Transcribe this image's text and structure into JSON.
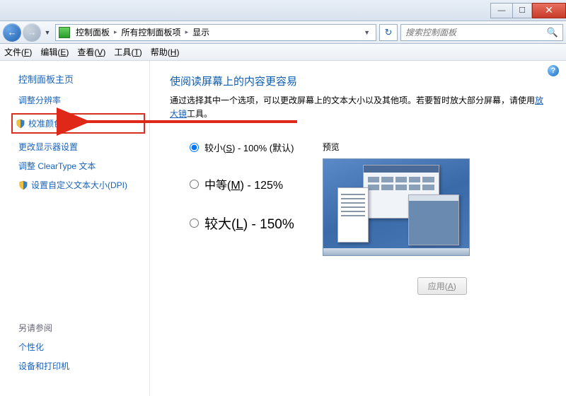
{
  "titlebar": {
    "min": "—",
    "max": "☐",
    "close": "✕"
  },
  "nav": {
    "back": "←",
    "forward": "→",
    "dropdown": "▼",
    "refresh": "↻",
    "crumbs": [
      "控制面板",
      "所有控制面板项",
      "显示"
    ],
    "sep": "▸",
    "addr_drop": "▼"
  },
  "search": {
    "placeholder": "搜索控制面板",
    "icon": "🔍"
  },
  "menu": {
    "items": [
      {
        "label": "文件",
        "key": "F"
      },
      {
        "label": "编辑",
        "key": "E"
      },
      {
        "label": "查看",
        "key": "V"
      },
      {
        "label": "工具",
        "key": "T"
      },
      {
        "label": "帮助",
        "key": "H"
      }
    ]
  },
  "sidebar": {
    "home": "控制面板主页",
    "links": [
      {
        "label": "调整分辨率",
        "shield": false
      },
      {
        "label": "校准颜色",
        "shield": true,
        "highlight": true
      },
      {
        "label": "更改显示器设置",
        "shield": false
      },
      {
        "label": "调整 ClearType 文本",
        "shield": false
      },
      {
        "label": "设置自定义文本大小(DPI)",
        "shield": true
      }
    ],
    "see_also_title": "另请参阅",
    "see_also": [
      "个性化",
      "设备和打印机"
    ]
  },
  "main": {
    "heading": "使阅读屏幕上的内容更容易",
    "description_pre": "通过选择其中一个选项，可以更改屏幕上的文本大小以及其他项。若要暂时放大部分屏幕，请使用",
    "magnifier_link": "放大镜",
    "description_post": "工具。",
    "options": [
      {
        "label": "较小",
        "key": "S",
        "suffix": " - 100% (默认)",
        "checked": true,
        "size": "normal"
      },
      {
        "label": "中等",
        "key": "M",
        "suffix": " - 125%",
        "checked": false,
        "size": "big"
      },
      {
        "label": "较大",
        "key": "L",
        "suffix": " - 150%",
        "checked": false,
        "size": "bigger"
      }
    ],
    "preview_label": "预览",
    "apply": "应用",
    "apply_key": "A"
  },
  "help_icon": "?"
}
